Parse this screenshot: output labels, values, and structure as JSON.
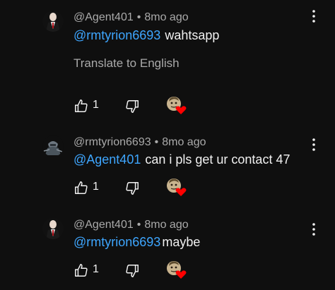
{
  "comments": [
    {
      "author": "@Agent401",
      "separator": "•",
      "time": "8mo ago",
      "mention": "@rmtyrion6693",
      "text": "wahtsapp",
      "translate": "Translate to English",
      "likes": "1"
    },
    {
      "author": "@rmtyrion6693",
      "separator": "•",
      "time": "8mo ago",
      "mention": "@Agent401",
      "text": "can i pls get ur contact 47",
      "likes": "1"
    },
    {
      "author": "@Agent401",
      "separator": "•",
      "time": "8mo ago",
      "mention": "@rmtyrion6693",
      "text": "maybe",
      "likes": "1"
    }
  ],
  "icons": {
    "like": "thumb-up-icon",
    "dislike": "thumb-down-icon",
    "menu": "more-vertical-icon",
    "heart": "creator-heart-icon"
  },
  "colors": {
    "background": "#0f0f0f",
    "mention": "#3ea6ff",
    "secondary_text": "#aaaaaa",
    "heart": "#ff0000"
  }
}
